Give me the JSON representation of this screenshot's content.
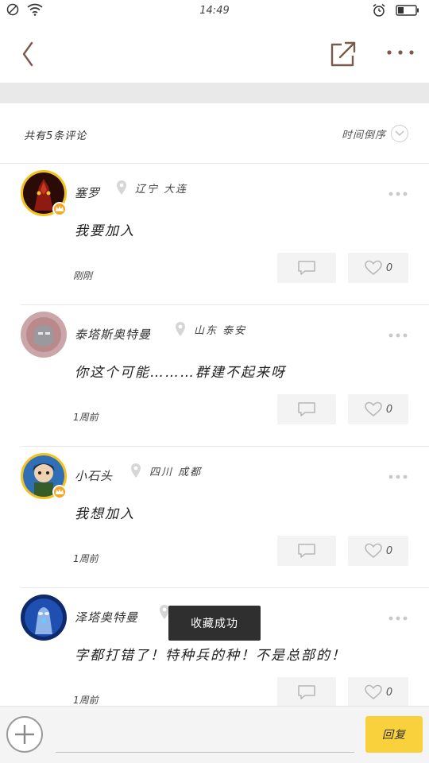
{
  "status_bar": {
    "time": "14:49"
  },
  "header": {
    "back_icon": "chevron-left-icon",
    "share_icon": "share-icon",
    "more_icon": "more-icon"
  },
  "comments_header": {
    "count_text": "共有5条评论",
    "sort_label": "时间倒序"
  },
  "comments": [
    {
      "username": "塞罗",
      "location": "辽宁 大连",
      "content": "我要加入",
      "time": "刚刚",
      "likes": "0",
      "vip": true
    },
    {
      "username": "泰塔斯奥特曼",
      "location": "山东 泰安",
      "content": "你这个可能………群建不起来呀",
      "time": "1周前",
      "likes": "0",
      "vip": false
    },
    {
      "username": "小石头",
      "location": "四川 成都",
      "content": "我想加入",
      "time": "1周前",
      "likes": "0",
      "vip": true
    },
    {
      "username": "泽塔奥特曼",
      "location": "",
      "content": "字都打错了！特种兵的种！不是总部的！",
      "time": "1周前",
      "likes": "0",
      "vip": false
    }
  ],
  "toast": {
    "text": "收藏成功"
  },
  "bottom_bar": {
    "input_placeholder": "",
    "submit_label": "回复"
  },
  "colors": {
    "accent": "#f8d13d",
    "vip_ring": "#f5c21b",
    "header_icon": "#7a5a4a"
  }
}
